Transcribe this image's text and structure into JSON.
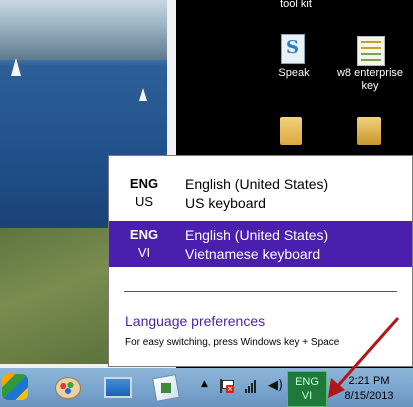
{
  "desktop": {
    "icons": [
      {
        "label": "tool kit",
        "icon": "toolkit-icon"
      },
      {
        "label": "Speak",
        "icon": "speak-icon"
      },
      {
        "label": "w8 enterprise key",
        "icon": "document-icon"
      },
      {
        "label": "",
        "icon": "folder-icon"
      },
      {
        "label": "",
        "icon": "folder-icon"
      }
    ]
  },
  "language_flyout": {
    "languages": [
      {
        "abbr_top": "ENG",
        "abbr_bottom": "US",
        "language": "English (United States)",
        "keyboard": "US keyboard",
        "selected": false
      },
      {
        "abbr_top": "ENG",
        "abbr_bottom": "VI",
        "language": "English (United States)",
        "keyboard": "Vietnamese keyboard",
        "selected": true
      }
    ],
    "preferences_link": "Language preferences",
    "hint": "For easy switching, press Windows key + Space",
    "selected_color": "#4b1fae"
  },
  "taskbar": {
    "buttons": [
      {
        "icon": "start-icon"
      },
      {
        "icon": "paint-icon"
      },
      {
        "icon": "monitor-icon"
      },
      {
        "icon": "remote-desktop-icon"
      }
    ],
    "tray": {
      "show_hidden_icon": "▲",
      "action_center_icon": "flag-icon",
      "network_icon": "signal-icon",
      "volume_icon": "speaker-icon",
      "input_indicator": {
        "top": "ENG",
        "bottom": "VI",
        "color": "#1d7a3c"
      },
      "clock": {
        "time": "2:21 PM",
        "date": "8/15/2013"
      }
    }
  }
}
